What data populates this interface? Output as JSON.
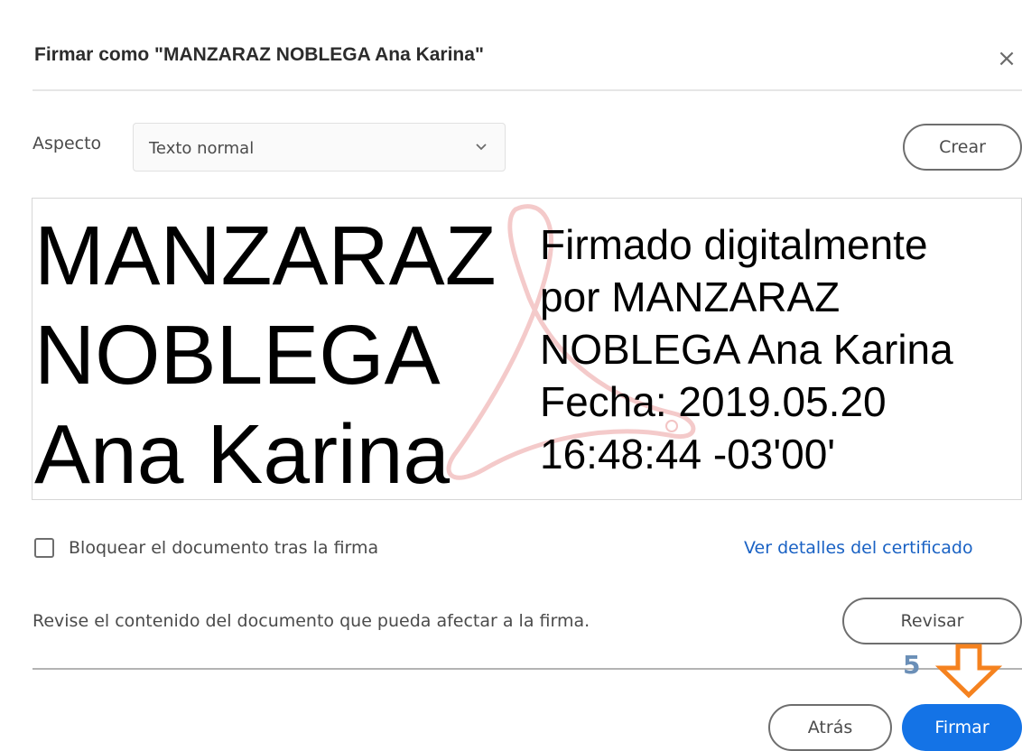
{
  "dialog": {
    "title": "Firmar como \"MANZARAZ NOBLEGA Ana Karina\"",
    "close_icon": "close-icon"
  },
  "appearance": {
    "label": "Aspecto",
    "selected_value": "Texto normal",
    "create_label": "Crear"
  },
  "preview": {
    "name_lines": [
      "MANZARAZ",
      "NOBLEGA",
      "Ana Karina"
    ],
    "detail_lines": [
      "Firmado digitalmente",
      "por MANZARAZ",
      "NOBLEGA Ana Karina",
      "Fecha: 2019.05.20",
      "16:48:44 -03'00'"
    ],
    "watermark_icon": "acrobat-logo-icon",
    "watermark_color": "#f3c4c4"
  },
  "lock": {
    "label": "Bloquear el documento tras la firma",
    "checked": false
  },
  "certificate_link": "Ver detalles del certificado",
  "review": {
    "text": "Revise el contenido del documento que pueda afectar a la firma.",
    "button_label": "Revisar"
  },
  "annotation": {
    "step_number": "5",
    "arrow_icon": "down-arrow-icon",
    "arrow_color": "#f5821f"
  },
  "footer": {
    "back_label": "Atrás",
    "sign_label": "Firmar",
    "accent_color": "#1473e6"
  }
}
